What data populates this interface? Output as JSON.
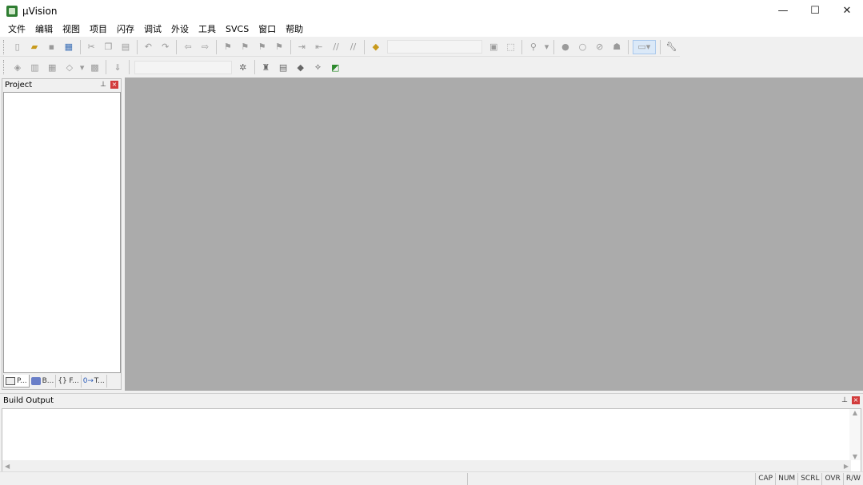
{
  "window": {
    "title": "µVision",
    "controls": {
      "minimize": "—",
      "maximize": "☐",
      "close": "✕"
    }
  },
  "menu": [
    "文件",
    "编辑",
    "视图",
    "项目",
    "闪存",
    "调试",
    "外设",
    "工具",
    "SVCS",
    "窗口",
    "帮助"
  ],
  "toolbar1": {
    "icons": [
      "new-file-icon",
      "open-file-icon",
      "save-icon",
      "save-all-icon",
      "cut-icon",
      "copy-icon",
      "paste-icon",
      "undo-icon",
      "redo-icon",
      "nav-back-icon",
      "nav-forward-icon",
      "bookmark-icon",
      "prev-bookmark-icon",
      "next-bookmark-icon",
      "clear-bookmarks-icon",
      "indent-icon",
      "unindent-icon",
      "comment-icon",
      "uncomment-icon",
      "find-in-files-icon",
      "find-icon",
      "incremental-find-icon",
      "debug-session-icon",
      "breakpoint-icon",
      "disable-breakpoint-icon",
      "disable-all-breakpoints-icon",
      "kill-breakpoints-icon",
      "window-layout-icon",
      "configure-icon"
    ],
    "search_combo_value": ""
  },
  "toolbar2": {
    "icons": [
      "translate-icon",
      "build-icon",
      "rebuild-icon",
      "batch-build-icon",
      "stop-build-icon",
      "download-icon",
      "target-options-icon",
      "manage-components-icon",
      "select-packs-icon",
      "pack-installer-icon",
      "run-time-environment-icon"
    ],
    "target_combo_value": ""
  },
  "project_panel": {
    "title": "Project",
    "tabs": [
      {
        "label": "P...",
        "icon": "project-tab-icon"
      },
      {
        "label": "B...",
        "icon": "books-tab-icon"
      },
      {
        "label": "F...",
        "icon": "functions-tab-icon"
      },
      {
        "label": "T...",
        "icon": "templates-tab-icon"
      }
    ]
  },
  "build_panel": {
    "title": "Build Output"
  },
  "statusbar": {
    "cells": [
      "CAP",
      "NUM",
      "SCRL",
      "OVR",
      "R/W"
    ]
  },
  "colors": {
    "editor_bg": "#ababab",
    "close_red": "#d23b3b",
    "panel_bg": "#f0f0f0"
  }
}
